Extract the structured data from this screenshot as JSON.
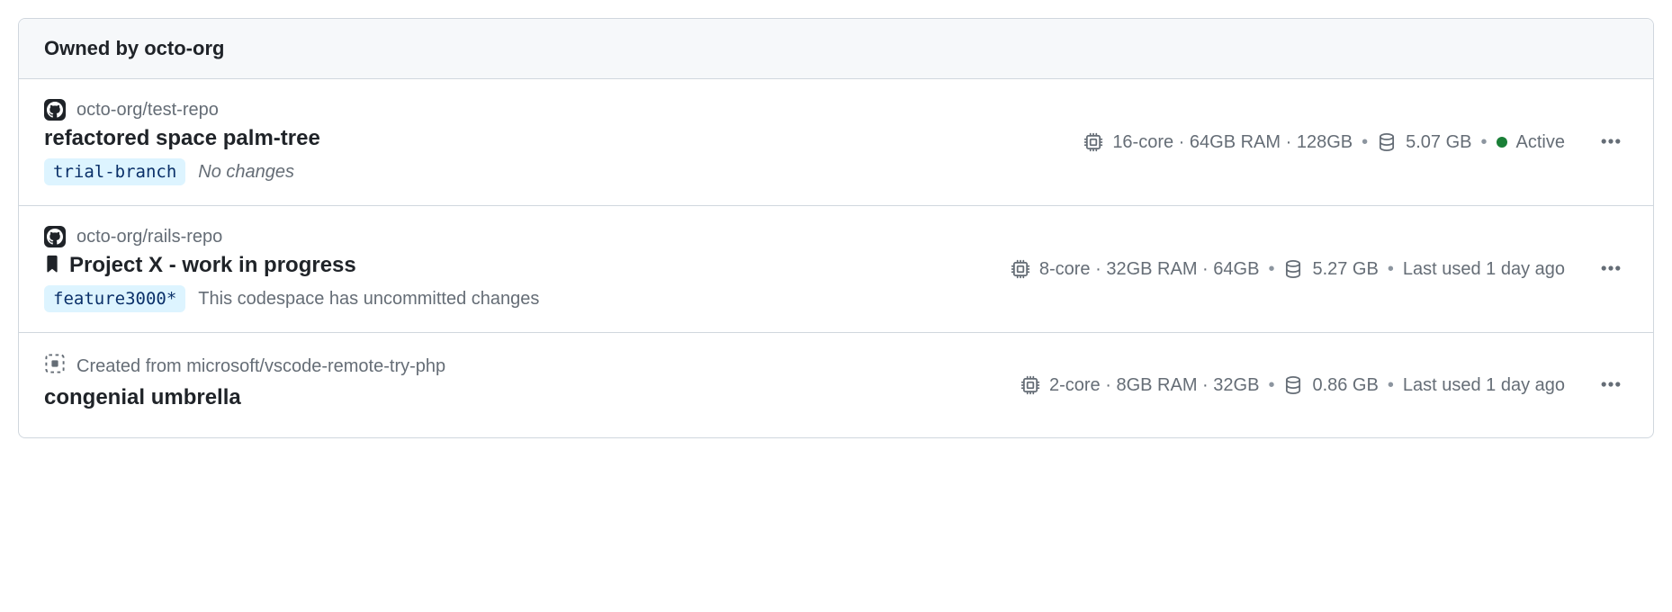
{
  "header": {
    "title": "Owned by octo-org"
  },
  "items": [
    {
      "repo": "octo-org/test-repo",
      "name": "refactored space palm-tree",
      "branch": "trial-branch",
      "changes": "No changes",
      "changes_italic": true,
      "bookmarked": false,
      "from_template": false,
      "cpu": "16-core",
      "ram": "64GB RAM",
      "disk": "128GB",
      "storage_used": "5.07 GB",
      "status_label": "Active",
      "status_active": true,
      "last_used": null
    },
    {
      "repo": "octo-org/rails-repo",
      "name": "Project X - work in progress",
      "branch": "feature3000*",
      "changes": "This codespace has uncommitted changes",
      "changes_italic": false,
      "bookmarked": true,
      "from_template": false,
      "cpu": "8-core",
      "ram": "32GB RAM",
      "disk": "64GB",
      "storage_used": "5.27 GB",
      "status_label": null,
      "status_active": false,
      "last_used": "Last used 1 day ago"
    },
    {
      "repo": "Created from microsoft/vscode-remote-try-php",
      "name": "congenial umbrella",
      "branch": null,
      "changes": null,
      "changes_italic": false,
      "bookmarked": false,
      "from_template": true,
      "cpu": "2-core",
      "ram": "8GB RAM",
      "disk": "32GB",
      "storage_used": "0.86 GB",
      "status_label": null,
      "status_active": false,
      "last_used": "Last used 1 day ago"
    }
  ]
}
